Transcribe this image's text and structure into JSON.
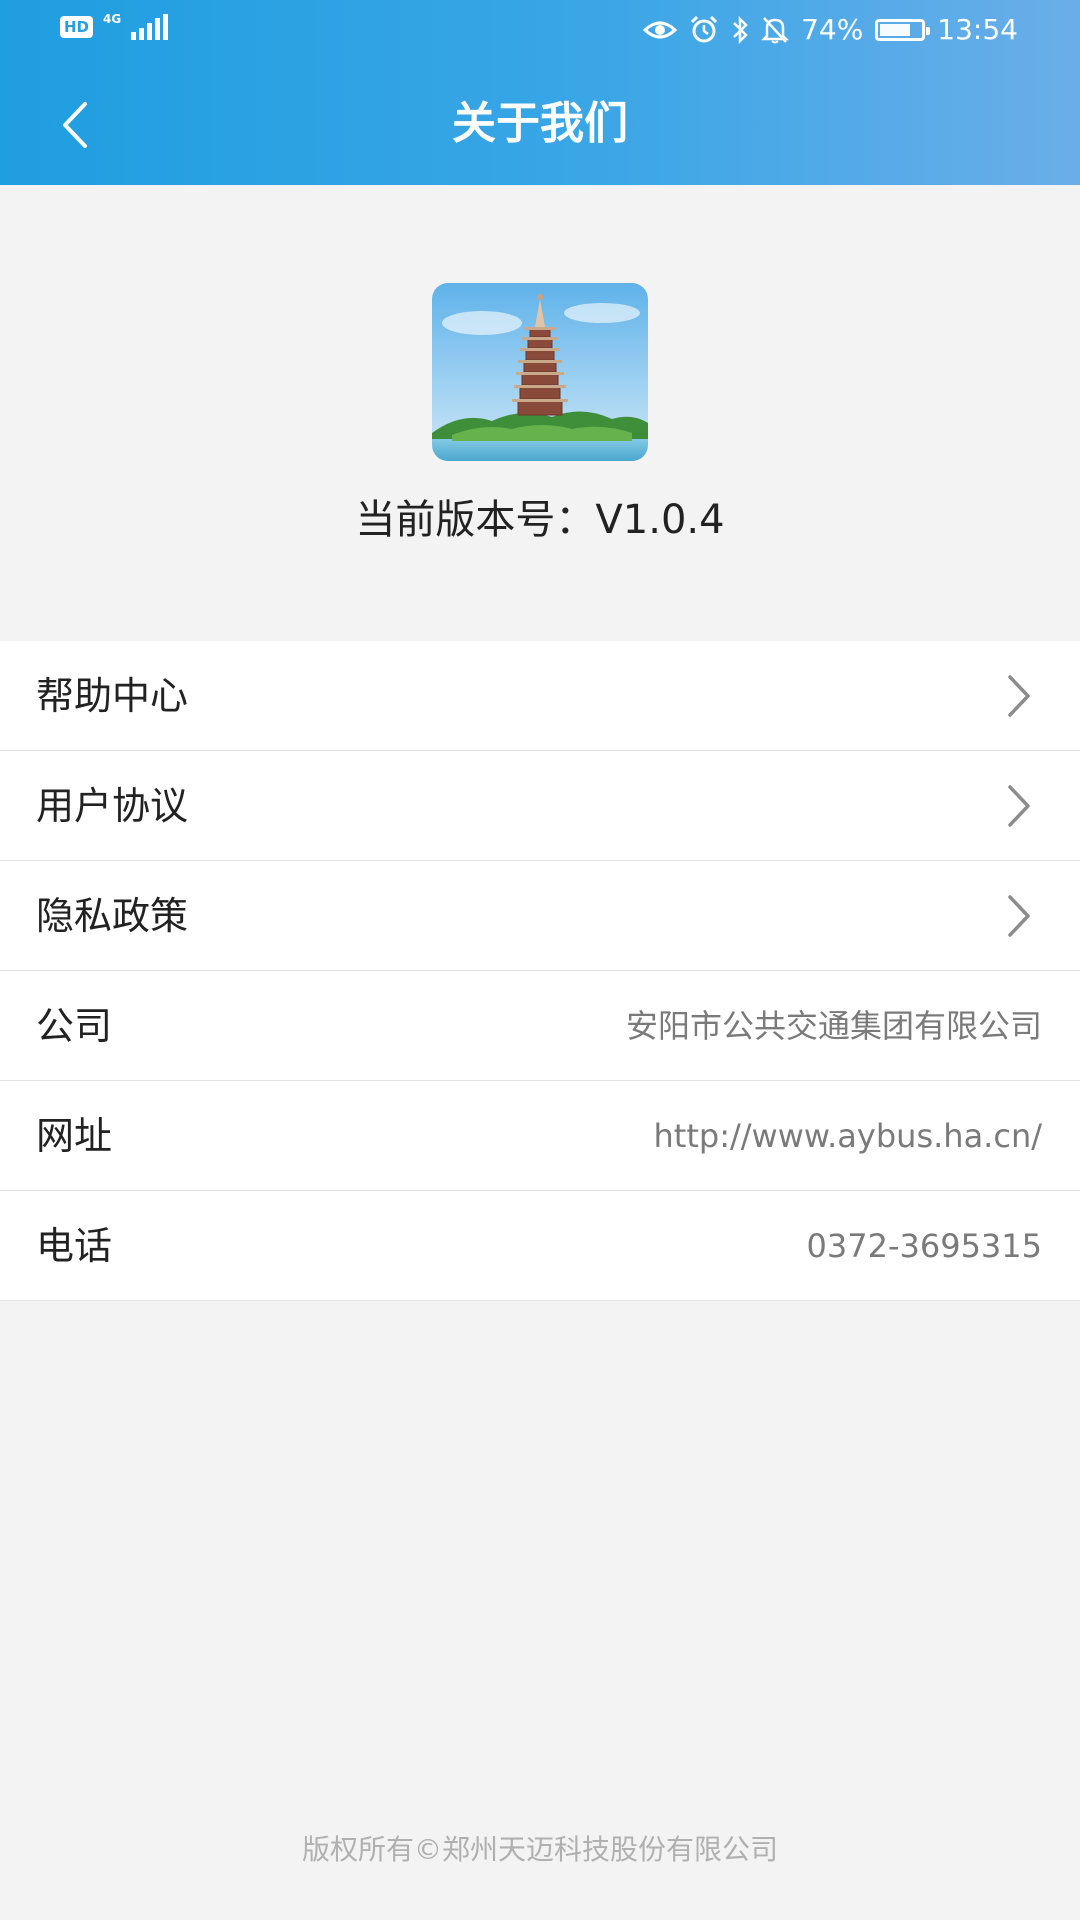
{
  "status_bar": {
    "hd": "HD",
    "network": "4G",
    "battery_text": "74%",
    "battery_level": 0.74,
    "time": "13:54",
    "icons": [
      "eye-icon",
      "alarm-icon",
      "bluetooth-icon",
      "mute-icon",
      "battery-icon"
    ]
  },
  "header": {
    "title": "关于我们",
    "back_icon": "back-chevron-icon"
  },
  "app": {
    "logo_icon": "pagoda-app-logo",
    "version_label": "当前版本号：V1.0.4"
  },
  "menu": [
    {
      "label": "帮助中心",
      "icon": "chevron-right-icon"
    },
    {
      "label": "用户协议",
      "icon": "chevron-right-icon"
    },
    {
      "label": "隐私政策",
      "icon": "chevron-right-icon"
    }
  ],
  "info": [
    {
      "label": "公司",
      "value": "安阳市公共交通集团有限公司"
    },
    {
      "label": "网址",
      "value": "http://www.aybus.ha.cn/"
    },
    {
      "label": "电话",
      "value": "0372-3695315"
    }
  ],
  "footer": {
    "copyright": "版权所有©郑州天迈科技股份有限公司"
  },
  "colors": {
    "header_gradient_start": "#1f9ee0",
    "header_gradient_end": "#6aaee9",
    "background": "#f3f3f3",
    "value_text": "#7a7a7a",
    "footer_text": "#b0b0b0"
  }
}
